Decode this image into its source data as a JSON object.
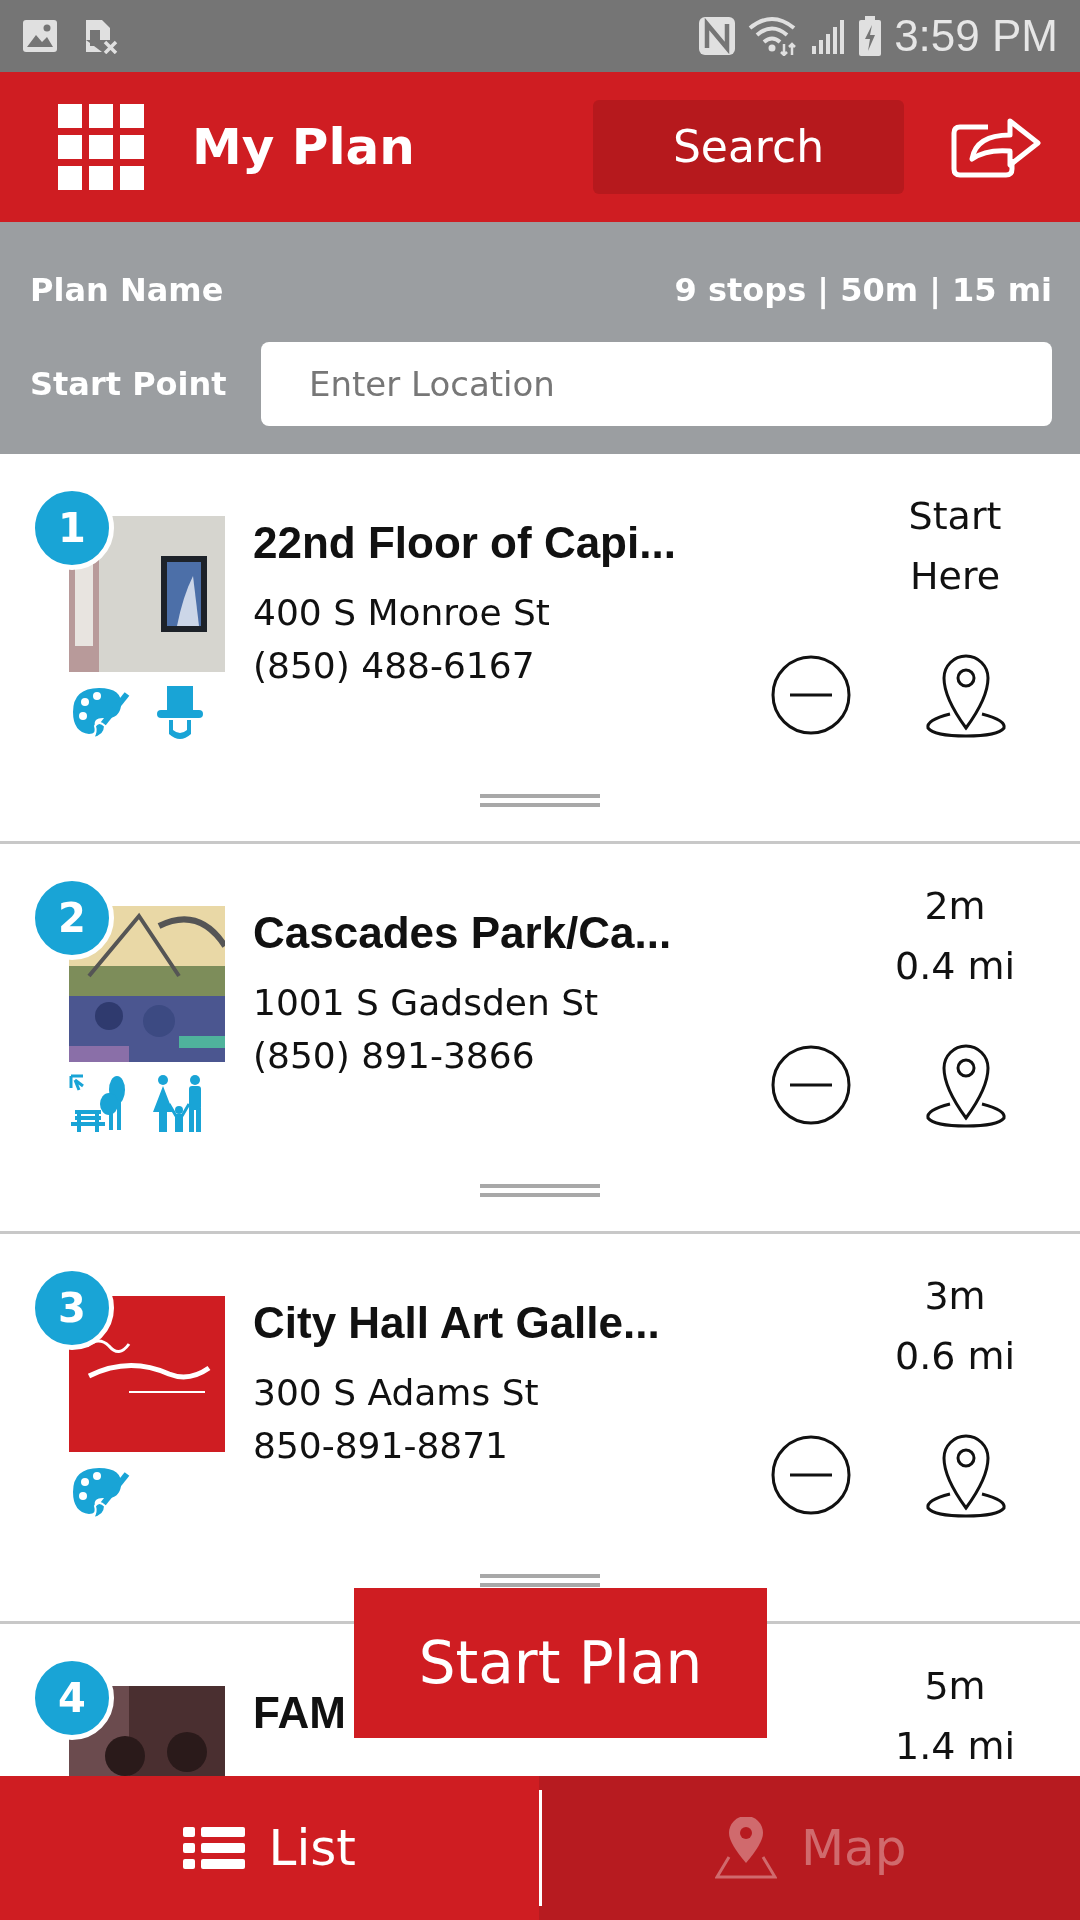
{
  "status_bar": {
    "time": "3:59 PM"
  },
  "header": {
    "title": "My Plan",
    "search_button": "Search"
  },
  "plan": {
    "name_label": "Plan Name",
    "summary": "9 stops | 50m | 15 mi",
    "start_label": "Start Point",
    "start_field": {
      "placeholder": "Enter Location"
    }
  },
  "stops": [
    {
      "number": "1",
      "image": {
        "kind": "picture"
      },
      "title": "22nd Floor of Capi...",
      "address": "400 S Monroe St",
      "phone": "(850) 488-6167",
      "eta": [
        "Start",
        "Here"
      ],
      "categories": [
        {
          "kind": "arts"
        },
        {
          "kind": "history"
        }
      ],
      "actions": [
        {
          "kind": "remove"
        },
        {
          "kind": "map"
        }
      ],
      "drag_handle": true
    },
    {
      "number": "2",
      "image": {
        "kind": "picture"
      },
      "title": "Cascades Park/Ca...",
      "address": "1001 S Gadsden St",
      "phone": "(850) 891-3866",
      "eta": [
        "2m",
        "0.4 mi"
      ],
      "categories": [
        {
          "kind": "park"
        },
        {
          "kind": "family"
        }
      ],
      "actions": [
        {
          "kind": "remove"
        },
        {
          "kind": "map"
        }
      ],
      "drag_handle": true
    },
    {
      "number": "3",
      "image": {
        "kind": "picture"
      },
      "title": "City Hall Art Galle...",
      "address": "300 S Adams St",
      "phone": "850-891-8871",
      "eta": [
        "3m",
        "0.6 mi"
      ],
      "categories": [
        {
          "kind": "arts"
        }
      ],
      "actions": [
        {
          "kind": "remove"
        },
        {
          "kind": "map"
        }
      ],
      "drag_handle": true
    },
    {
      "number": "4",
      "image": {
        "kind": "picture"
      },
      "title": "FAM",
      "eta": [
        "5m",
        "1.4 mi"
      ]
    }
  ],
  "start_button": "Start Plan",
  "tabs": [
    {
      "label": "List",
      "selected": true
    },
    {
      "label": "Map",
      "selected": false
    }
  ]
}
